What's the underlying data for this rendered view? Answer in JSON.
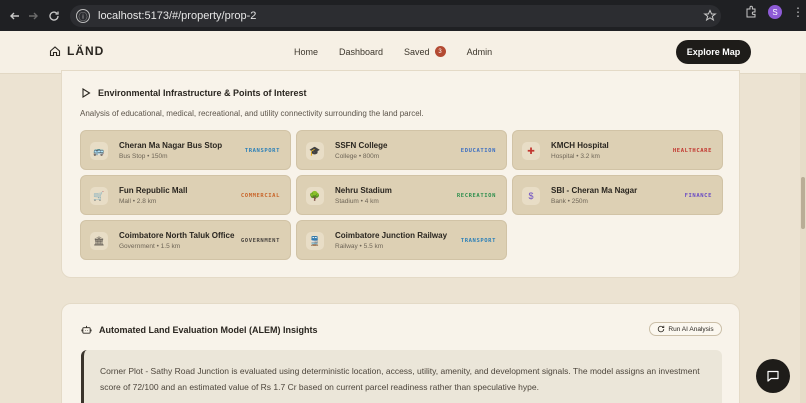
{
  "browser": {
    "url": "localhost:5173/#/property/prop-2",
    "profile_initial": "S"
  },
  "header": {
    "brand": "LÄND",
    "nav": [
      {
        "label": "Home"
      },
      {
        "label": "Dashboard"
      },
      {
        "label": "Saved",
        "badge": "3"
      },
      {
        "label": "Admin"
      }
    ],
    "cta": "Explore Map"
  },
  "infrastructure": {
    "title": "Environmental Infrastructure & Points of Interest",
    "description": "Analysis of educational, medical, recreational, and utility connectivity surrounding the land parcel.",
    "items": [
      {
        "name": "Cheran Ma Nagar Bus Stop",
        "meta": "Bus Stop • 150m",
        "category": "TRANSPORT",
        "icon": "bus-icon",
        "glyph": "🚌",
        "color": "#2a7fb8"
      },
      {
        "name": "SSFN College",
        "meta": "College • 800m",
        "category": "EDUCATION",
        "icon": "graduation-cap-icon",
        "glyph": "🎓",
        "color": "#3d6fc2"
      },
      {
        "name": "KMCH Hospital",
        "meta": "Hospital • 3.2 km",
        "category": "HEALTHCARE",
        "icon": "hospital-icon",
        "glyph": "✚",
        "color": "#c2362f"
      },
      {
        "name": "Fun Republic Mall",
        "meta": "Mall • 2.8 km",
        "category": "COMMERCIAL",
        "icon": "shopping-cart-icon",
        "glyph": "🛒",
        "color": "#c8652a"
      },
      {
        "name": "Nehru Stadium",
        "meta": "Stadium • 4 km",
        "category": "RECREATION",
        "icon": "tree-icon",
        "glyph": "🌳",
        "color": "#2f8f4e"
      },
      {
        "name": "SBI - Cheran Ma Nagar",
        "meta": "Bank • 250m",
        "category": "FINANCE",
        "icon": "dollar-icon",
        "glyph": "$",
        "color": "#6a4bc4"
      },
      {
        "name": "Coimbatore North Taluk Office",
        "meta": "Government • 1.5 km",
        "category": "GOVERNMENT",
        "icon": "government-building-icon",
        "glyph": "🏛",
        "color": "#4a4540"
      },
      {
        "name": "Coimbatore Junction Railway",
        "meta": "Railway • 5.5 km",
        "category": "TRANSPORT",
        "icon": "train-icon",
        "glyph": "🚆",
        "color": "#2a7fb8"
      }
    ]
  },
  "alem": {
    "title": "Automated Land Evaluation Model (ALEM) Insights",
    "run_label": "Run AI Analysis",
    "summary": "Corner Plot - Sathy Road Junction is evaluated using deterministic location, access, utility, amenity, and development signals. The model assigns an investment score of 72/100 and an estimated value of Rs 1.7 Cr based on current parcel readiness rather than speculative hype."
  }
}
